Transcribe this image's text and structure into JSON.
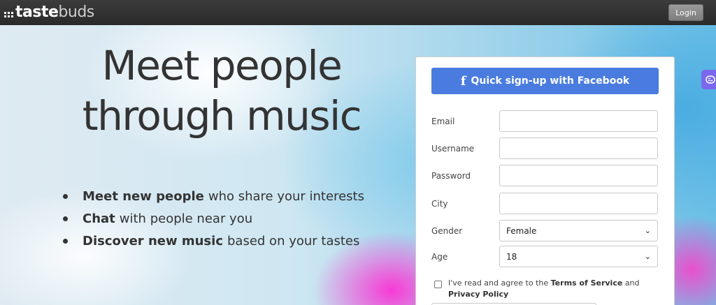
{
  "header": {
    "logo_part1": "taste",
    "logo_part2": "buds",
    "login_label": "Login"
  },
  "hero": {
    "headline_line1": "Meet people",
    "headline_line2": "through music",
    "features": [
      {
        "bold": "Meet new people",
        "rest": "who share your interests"
      },
      {
        "bold": "Chat",
        "rest": "with people near you"
      },
      {
        "bold": "Discover new music",
        "rest": "based on your tastes"
      }
    ]
  },
  "signup": {
    "facebook_icon": "f",
    "facebook_label": "Quick sign-up with Facebook",
    "email_label": "Email",
    "email_value": "",
    "username_label": "Username",
    "username_value": "",
    "password_label": "Password",
    "password_value": "",
    "city_label": "City",
    "city_value": "",
    "gender_label": "Gender",
    "gender_value": "Female",
    "age_label": "Age",
    "age_value": "18",
    "terms_prefix": "I've read and agree to the",
    "terms_link": "Terms of Service",
    "terms_and": "and",
    "privacy_link": "Privacy Policy"
  },
  "icons": {
    "side_widget": "brain-icon",
    "dropdown": "chevron-down-icon"
  },
  "colors": {
    "topbar": "#2f2f2f",
    "facebook": "#4a7ce0",
    "side_widget": "#7b68ee",
    "text": "#333333"
  }
}
